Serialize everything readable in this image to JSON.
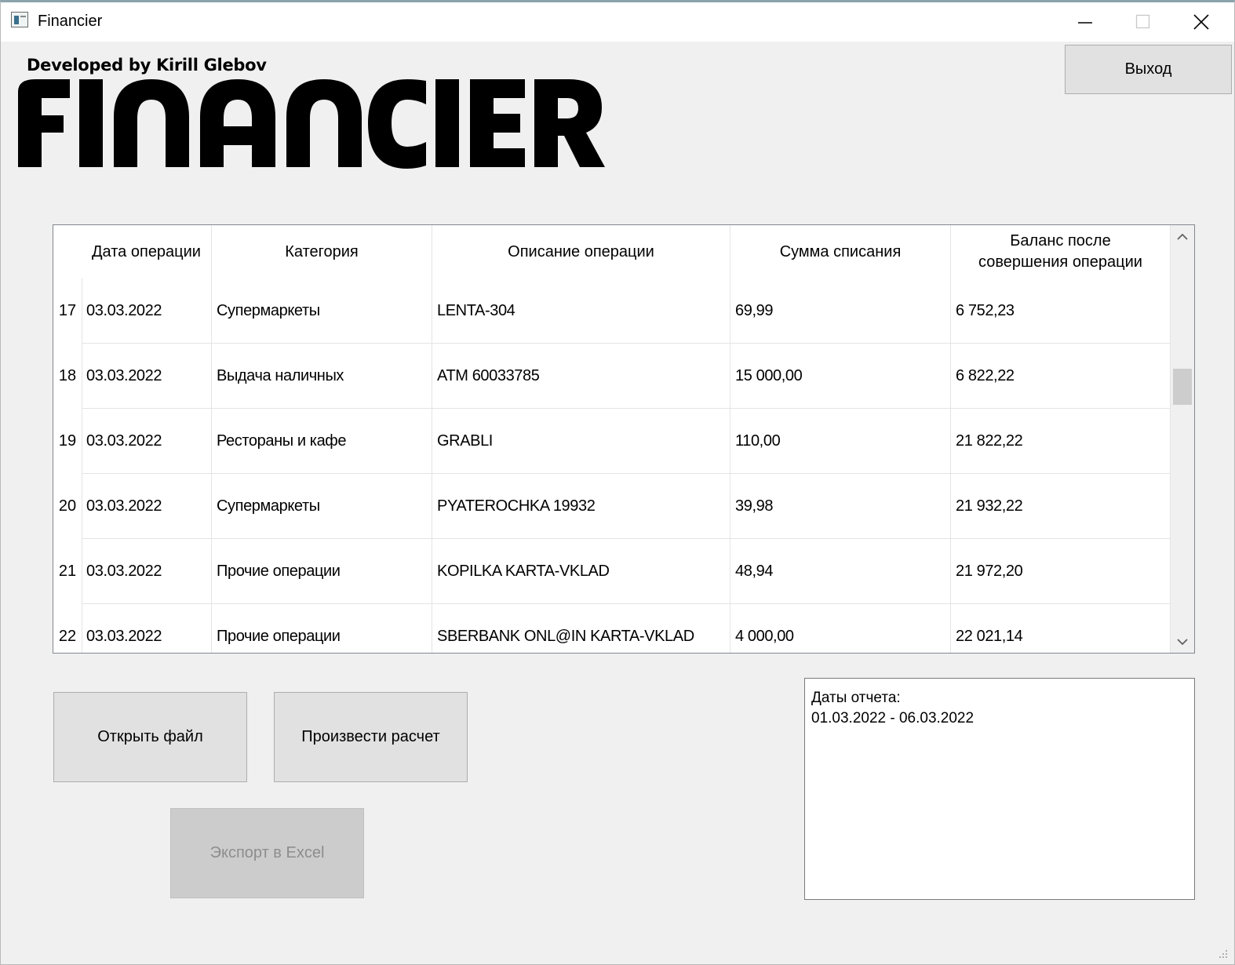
{
  "window": {
    "title": "Financier"
  },
  "header": {
    "developed_by": "Developed by Kirill Glebov",
    "logo_text": "FINANCIER"
  },
  "toolbar": {
    "exit_label": "Выход"
  },
  "table": {
    "columns": [
      "Дата операции",
      "Категория",
      "Описание операции",
      "Сумма списания",
      "Баланс после совершения операции"
    ],
    "rows": [
      {
        "num": "17",
        "date": "03.03.2022",
        "category": "Супермаркеты",
        "description": "LENTA-304",
        "amount": "69,99",
        "balance": "6 752,23"
      },
      {
        "num": "18",
        "date": "03.03.2022",
        "category": "Выдача наличных",
        "description": "ATM 60033785",
        "amount": "15 000,00",
        "balance": "6 822,22"
      },
      {
        "num": "19",
        "date": "03.03.2022",
        "category": "Рестораны и кафе",
        "description": "GRABLI",
        "amount": "110,00",
        "balance": "21 822,22"
      },
      {
        "num": "20",
        "date": "03.03.2022",
        "category": "Супермаркеты",
        "description": "PYATEROCHKA 19932",
        "amount": "39,98",
        "balance": "21 932,22"
      },
      {
        "num": "21",
        "date": "03.03.2022",
        "category": "Прочие операции",
        "description": "KOPILKA KARTA-VKLAD",
        "amount": "48,94",
        "balance": "21 972,20"
      },
      {
        "num": "22",
        "date": "03.03.2022",
        "category": "Прочие операции",
        "description": "SBERBANK ONL@IN KARTA-VKLAD",
        "amount": "4 000,00",
        "balance": "22 021,14"
      }
    ]
  },
  "actions": {
    "open_file": "Открыть файл",
    "calculate": "Произвести расчет",
    "export_excel": "Экспорт в Excel",
    "export_enabled": false
  },
  "report": {
    "label": "Даты отчета:",
    "range": "01.03.2022 - 06.03.2022"
  },
  "icons": {
    "app": "app-icon",
    "minimize": "minimize-icon",
    "maximize": "maximize-icon",
    "close": "close-icon",
    "scroll_up": "chevron-up-icon",
    "scroll_down": "chevron-down-icon",
    "resize_grip": "resize-grip-icon"
  }
}
